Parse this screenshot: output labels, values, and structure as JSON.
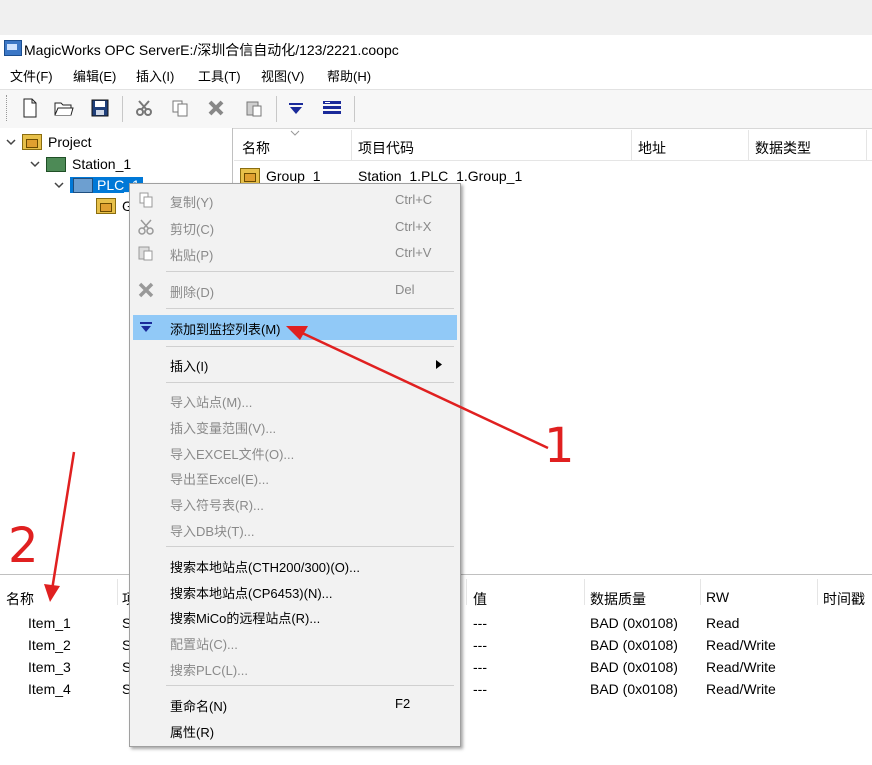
{
  "window": {
    "title": "MagicWorks OPC ServerE:/深圳合信自动化/123/2221.coopc"
  },
  "menubar": {
    "items": [
      "文件(F)",
      "编辑(E)",
      "插入(I)",
      "工具(T)",
      "视图(V)",
      "帮助(H)"
    ]
  },
  "toolbar": {
    "buttons": [
      "new-file-icon",
      "open-folder-icon",
      "save-icon",
      "cut-icon",
      "copy-icon",
      "delete-icon",
      "paste-icon",
      "add-to-monitor-icon",
      "monitor-list-icon"
    ]
  },
  "tree": {
    "project": "Project",
    "station": "Station_1",
    "plc": "PLC_1",
    "group_partial": "G"
  },
  "list": {
    "headers": [
      "名称",
      "项目代码",
      "地址",
      "数据类型"
    ],
    "rows": [
      {
        "name": "Group_1",
        "code": "Station_1.PLC_1.Group_1"
      }
    ]
  },
  "monitor": {
    "headers": [
      "名称",
      "项",
      "值",
      "数据质量",
      "RW",
      "时间戳"
    ],
    "rows": [
      {
        "name": "Item_1",
        "item": "S",
        "value": "---",
        "quality": "BAD (0x0108)",
        "rw": "Read"
      },
      {
        "name": "Item_2",
        "item": "S",
        "value": "---",
        "quality": "BAD (0x0108)",
        "rw": "Read/Write"
      },
      {
        "name": "Item_3",
        "item": "S",
        "value": "---",
        "quality": "BAD (0x0108)",
        "rw": "Read/Write"
      },
      {
        "name": "Item_4",
        "item": "S",
        "value": "---",
        "quality": "BAD (0x0108)",
        "rw": "Read/Write"
      }
    ]
  },
  "context_menu": {
    "items": [
      {
        "label": "复制(Y)",
        "shortcut": "Ctrl+C",
        "enabled": false,
        "icon": "copy-icon"
      },
      {
        "label": "剪切(C)",
        "shortcut": "Ctrl+X",
        "enabled": false,
        "icon": "cut-icon"
      },
      {
        "label": "粘贴(P)",
        "shortcut": "Ctrl+V",
        "enabled": false,
        "icon": "paste-icon"
      },
      {
        "label": "删除(D)",
        "shortcut": "Del",
        "enabled": false,
        "icon": "delete-icon"
      },
      {
        "label": "添加到监控列表(M)",
        "shortcut": "",
        "enabled": true,
        "icon": "add-to-monitor-icon",
        "highlighted": true
      },
      {
        "label": "插入(I)",
        "shortcut": "",
        "enabled": true,
        "submenu": true
      },
      {
        "label": "导入站点(M)...",
        "shortcut": "",
        "enabled": false
      },
      {
        "label": "插入变量范围(V)...",
        "shortcut": "",
        "enabled": false
      },
      {
        "label": "导入EXCEL文件(O)...",
        "shortcut": "",
        "enabled": false
      },
      {
        "label": "导出至Excel(E)...",
        "shortcut": "",
        "enabled": false
      },
      {
        "label": "导入符号表(R)...",
        "shortcut": "",
        "enabled": false
      },
      {
        "label": "导入DB块(T)...",
        "shortcut": "",
        "enabled": false
      },
      {
        "label": "搜索本地站点(CTH200/300)(O)...",
        "shortcut": "",
        "enabled": true
      },
      {
        "label": "搜索本地站点(CP6453)(N)...",
        "shortcut": "",
        "enabled": true
      },
      {
        "label": "搜索MiCo的远程站点(R)...",
        "shortcut": "",
        "enabled": true
      },
      {
        "label": "配置站(C)...",
        "shortcut": "",
        "enabled": false
      },
      {
        "label": "搜索PLC(L)...",
        "shortcut": "",
        "enabled": false
      },
      {
        "label": "重命名(N)",
        "shortcut": "F2",
        "enabled": true
      },
      {
        "label": "属性(R)",
        "shortcut": "",
        "enabled": true
      }
    ]
  },
  "annotations": {
    "label_1": "1",
    "label_2": "2",
    "color": "#e02020"
  },
  "colors": {
    "selection": "#0078d7",
    "menu_highlight": "#91c9f7",
    "annotation": "#e02020"
  }
}
